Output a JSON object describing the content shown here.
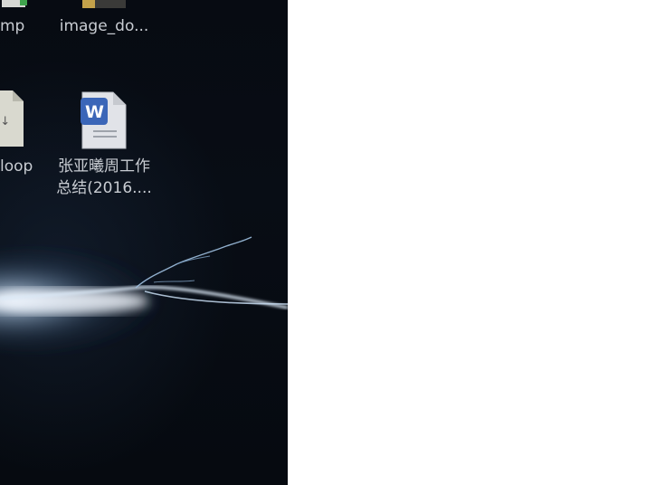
{
  "desktop": {
    "icons": [
      {
        "label": "mp"
      },
      {
        "label": "image_do..."
      },
      {
        "label": "loop"
      },
      {
        "label_line1": "张亚曦周工作",
        "label_line2": "总结(2016...."
      }
    ]
  },
  "colors": {
    "desktop_bg": "#070b12",
    "label_text": "#c8ccd2",
    "right_panel": "#ffffff",
    "word_blue": "#3b66b8"
  },
  "icon_names": [
    "folder-icon",
    "folder-icon",
    "markdown-file-icon",
    "word-document-icon"
  ]
}
